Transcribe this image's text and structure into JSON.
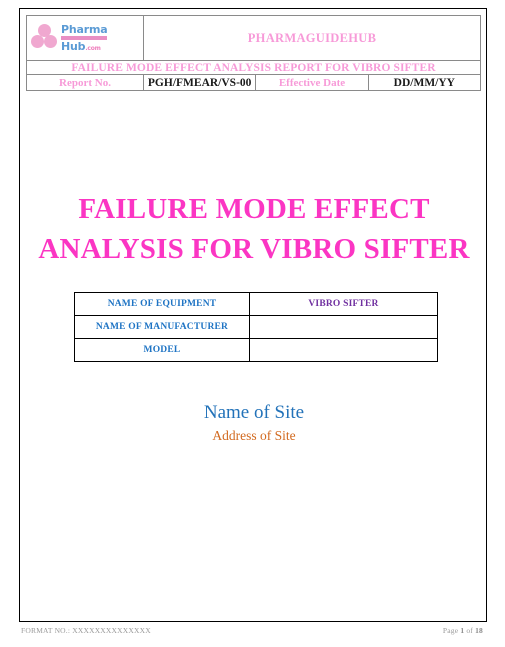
{
  "document": {
    "header": {
      "logo": {
        "name": "pharmahub-logo",
        "pharma_text": "Pharma",
        "hub_text": "Hub",
        "com_text": ".com",
        "dot_color_light": "#f2aed4",
        "dot_color_dark": "#ef5fae",
        "text_color": "#5b9bd5"
      },
      "brand_title": "PHARMAGUIDEHUB",
      "banner": "FAILURE MODE EFFECT ANALYSIS REPORT FOR VIBRO SIFTER",
      "meta": {
        "report_no_label": "Report No.",
        "report_no_value": "PGH/FMEAR/VS-00",
        "effective_date_label": "Effective Date",
        "effective_date_value": "DD/MM/YY"
      },
      "accent_color": "#f79ad8"
    },
    "title": {
      "line1": "FAILURE MODE EFFECT",
      "line2": "ANALYSIS FOR VIBRO SIFTER",
      "color": "#fb35c3"
    },
    "equipment_table": {
      "label_color": "#1f74c4",
      "value_color": "#7030a0",
      "rows": [
        {
          "label": "NAME OF EQUIPMENT",
          "value": "VIBRO SIFTER"
        },
        {
          "label": "NAME OF MANUFACTURER",
          "value": ""
        },
        {
          "label": "MODEL",
          "value": ""
        }
      ]
    },
    "site": {
      "name": "Name of Site",
      "name_color": "#2272b9",
      "address": "Address of Site",
      "address_color": "#d2691e"
    },
    "footer": {
      "format_no": "FORMAT NO.: XXXXXXXXXXXXXX",
      "page_label": "Page",
      "page_current": "1",
      "page_of": "of",
      "page_total": "18"
    }
  }
}
